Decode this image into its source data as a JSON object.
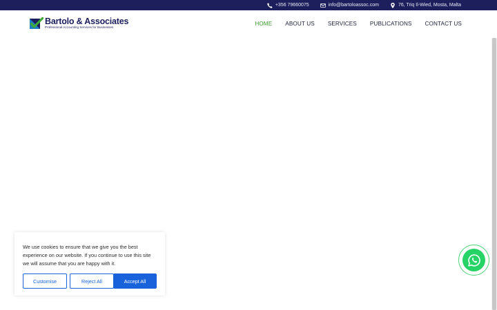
{
  "topbar": {
    "phone": "+356 79660075",
    "email": "info@bartoloassoc.com",
    "address": "76, Triq Il-Wied, Mosta, Malta"
  },
  "logo": {
    "name": "Bartolo & Associates",
    "tagline": "Professional Accounting Services for Businesses"
  },
  "nav": {
    "items": [
      {
        "label": "HOME",
        "active": true
      },
      {
        "label": "ABOUT US"
      },
      {
        "label": "SERVICES"
      },
      {
        "label": "PUBLICATIONS"
      },
      {
        "label": "CONTACT US"
      }
    ]
  },
  "cookie": {
    "message": "We use cookies to ensure that we give you the best experience on our website. If you continue to use this site we will assume that you are happy with it.",
    "customise_label": "Customise",
    "reject_label": "Reject All",
    "accept_label": "Accept All"
  },
  "icons": {
    "phone": "phone-icon",
    "email": "envelope-icon",
    "address": "map-pin-icon",
    "whatsapp": "whatsapp-icon"
  },
  "colors": {
    "topbar_bg": "#1c1f5c",
    "nav_active": "#3d9b2f",
    "button_blue": "#1863dc",
    "whatsapp_green": "#25d366"
  }
}
